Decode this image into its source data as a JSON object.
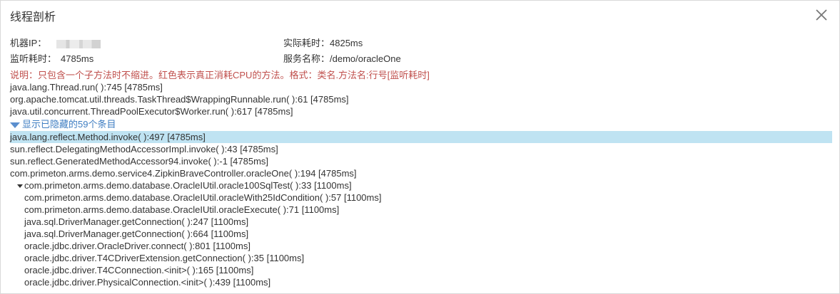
{
  "dialog": {
    "title": "线程剖析",
    "close_icon": "close-icon"
  },
  "info": {
    "ip_label": "机器IP：",
    "actual_time_label": "实际耗时：",
    "actual_time_value": "4825ms",
    "monitor_time_label": "监听耗时：",
    "monitor_time_value": "4785ms",
    "service_label": "服务名称：",
    "service_value": "/demo/oracleOne"
  },
  "note": "说明：只包含一个子方法时不缩进。红色表示真正消耗CPU的方法。格式：类名.方法名:行号[监听耗时]",
  "trace": {
    "top_lines": [
      "java.lang.Thread.run( ):745 [4785ms]",
      "org.apache.tomcat.util.threads.TaskThread$WrappingRunnable.run( ):61 [4785ms]",
      "java.util.concurrent.ThreadPoolExecutor$Worker.run( ):617 [4785ms]"
    ],
    "hidden_toggle": "显示已隐藏的59个条目",
    "highlighted": "java.lang.reflect.Method.invoke( ):497 [4785ms]",
    "lines_after": [
      "sun.reflect.DelegatingMethodAccessorImpl.invoke( ):43 [4785ms]",
      "sun.reflect.GeneratedMethodAccessor94.invoke( ):-1 [4785ms]",
      "com.primeton.arms.demo.service4.ZipkinBraveController.oracleOne( ):194 [4785ms]"
    ],
    "expanded_node": "com.primeton.arms.demo.database.OracleIUtil.oracle100SqlTest( ):33 [1100ms]",
    "child_lines": [
      "com.primeton.arms.demo.database.OracleIUtil.oracleWith25IdCondition( ):57 [1100ms]",
      "com.primeton.arms.demo.database.OracleIUtil.oracleExecute( ):71 [1100ms]",
      "java.sql.DriverManager.getConnection( ):247 [1100ms]",
      "java.sql.DriverManager.getConnection( ):664 [1100ms]",
      "oracle.jdbc.driver.OracleDriver.connect( ):801 [1100ms]",
      "oracle.jdbc.driver.T4CDriverExtension.getConnection( ):35 [1100ms]",
      "oracle.jdbc.driver.T4CConnection.<init>( ):165 [1100ms]",
      "oracle.jdbc.driver.PhysicalConnection.<init>( ):439 [1100ms]"
    ]
  }
}
